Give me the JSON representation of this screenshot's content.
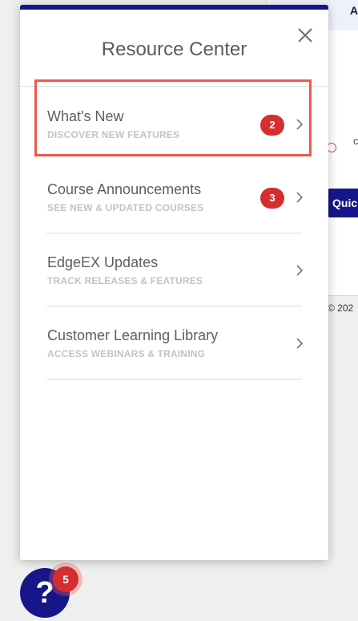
{
  "background": {
    "header_text": "A",
    "faded_text": "c",
    "quick_button_label": "Quic",
    "copyright_text": "© 202"
  },
  "resource_center": {
    "title": "Resource Center",
    "close_icon": "close-icon",
    "items": [
      {
        "title": "What's New",
        "subtitle": "DISCOVER NEW FEATURES",
        "badge": "2",
        "highlighted": true
      },
      {
        "title": "Course Announcements",
        "subtitle": "SEE NEW & UPDATED COURSES",
        "badge": "3"
      },
      {
        "title": "EdgeEX Updates",
        "subtitle": "TRACK RELEASES & FEATURES"
      },
      {
        "title": "Customer Learning Library",
        "subtitle": "ACCESS WEBINARS & TRAINING"
      }
    ]
  },
  "help_launcher": {
    "glyph": "?",
    "badge": "5"
  },
  "colors": {
    "brand": "#16168a",
    "badge": "#d42e2e",
    "highlight": "#f0584f"
  }
}
